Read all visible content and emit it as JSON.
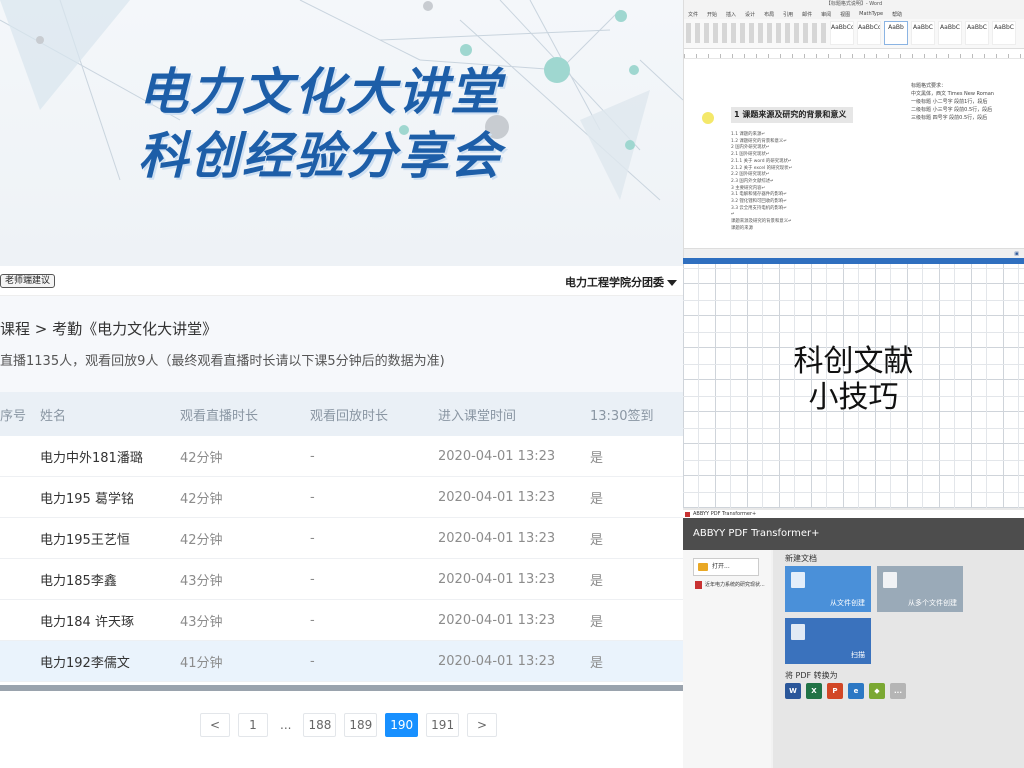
{
  "banner": {
    "line1": "电力文化大讲堂",
    "line2": "科创经验分享会"
  },
  "attendance": {
    "tag": "老师端建议",
    "school": "电力工程学院分团委",
    "breadcrumb": "课程 > 考勤《电力文化大讲堂》",
    "summary": "直播1135人，观看回放9人（最终观看直播时长请以下课5分钟后的数据为准)",
    "columns": [
      "序号",
      "姓名",
      "观看直播时长",
      "观看回放时长",
      "进入课堂时间",
      "13:30签到"
    ],
    "rows": [
      {
        "name": "电力中外181潘璐",
        "live": "42分钟",
        "replay": "-",
        "time": "2020-04-01 13:23",
        "signed": "是"
      },
      {
        "name": "电力195 葛学铭",
        "live": "42分钟",
        "replay": "-",
        "time": "2020-04-01 13:23",
        "signed": "是"
      },
      {
        "name": "电力195王艺恒",
        "live": "42分钟",
        "replay": "-",
        "time": "2020-04-01 13:23",
        "signed": "是"
      },
      {
        "name": "电力185李鑫",
        "live": "43分钟",
        "replay": "-",
        "time": "2020-04-01 13:23",
        "signed": "是"
      },
      {
        "name": "电力184 许天琢",
        "live": "43分钟",
        "replay": "-",
        "time": "2020-04-01 13:23",
        "signed": "是"
      },
      {
        "name": "电力192李儒文",
        "live": "41分钟",
        "replay": "-",
        "time": "2020-04-01 13:23",
        "signed": "是"
      }
    ],
    "pager": {
      "prev": "<",
      "first": "1",
      "ellipsis": "...",
      "p1": "188",
      "p2": "189",
      "current": "190",
      "p3": "191",
      "next": ">"
    }
  },
  "word": {
    "title": "【标题格式说明】- Word",
    "tabs": [
      "文件",
      "开始",
      "插入",
      "设计",
      "布局",
      "引用",
      "邮件",
      "审阅",
      "视图",
      "MathType",
      "帮助"
    ],
    "styles": [
      "AaBbCcD",
      "AaBbCcD",
      "AaBb",
      "AaBbC",
      "AaBbC",
      "AaBbC",
      "AaBbC"
    ],
    "heading": "1 课题来源及研究的背景和意义",
    "lines": [
      "1.1 课题的来源↵",
      "1.2 课题研究的背景和意义↵",
      "2 国内外研究现状↵",
      "2.1 国外研究现状↵",
      "2.1.1 关于 word 的研究现状↵",
      "2.1.2 关于 excel 的研究现状↵",
      "2.2 国外研究现状↵",
      "2.3 国内外文献综述↵",
      "3 主要研究内容↵",
      "3.1 电解和储存器件的影响↵",
      "3.2 锂化锂和可回收的影响↵",
      "3.3 云全用支持电机的影响↵",
      "↵",
      "课题来源及研究的背景和意义↵",
      "课题的来源"
    ],
    "notes": [
      "标题格式要求：",
      "中文黑体，西文 Times New Roman",
      "一级标题   小二号字 段前1行，段后",
      "二级标题   小三号字 段前0.5行，段后",
      "三级标题   四号字   段前0.5行，段后"
    ]
  },
  "grid": {
    "line1": "科创文献",
    "line2": "小技巧"
  },
  "abbyy": {
    "window_title": "ABBYY PDF Transformer+",
    "header": "ABBYY PDF Transformer+",
    "open_label": "打开...",
    "recent_label": "近年电力系统的研究现状...",
    "new_doc_label": "新建文档",
    "tile1": "从文件创建",
    "tile2": "从多个文件创建",
    "tile3": "扫描",
    "convert_label": "将 PDF 转换为",
    "convert_icons": [
      "W",
      "X",
      "P",
      "e",
      "◆",
      "..."
    ]
  }
}
